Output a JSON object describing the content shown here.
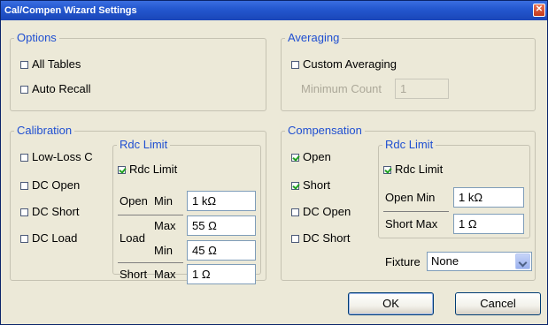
{
  "window": {
    "title": "Cal/Compen Wizard Settings",
    "close_glyph": "✕"
  },
  "options": {
    "title": "Options",
    "all_tables": {
      "label": "All Tables",
      "checked": false
    },
    "auto_recall": {
      "label": "Auto Recall",
      "checked": false
    }
  },
  "averaging": {
    "title": "Averaging",
    "custom_averaging": {
      "label": "Custom Averaging",
      "checked": false
    },
    "minimum_count_label": "Minimum Count",
    "minimum_count_value": "1"
  },
  "calibration": {
    "title": "Calibration",
    "low_loss_c": {
      "label": "Low-Loss C",
      "checked": false
    },
    "dc_open": {
      "label": "DC Open",
      "checked": false
    },
    "dc_short": {
      "label": "DC Short",
      "checked": false
    },
    "dc_load": {
      "label": "DC Load",
      "checked": false
    },
    "rdc": {
      "title": "Rdc Limit",
      "enable": {
        "label": "Rdc Limit",
        "checked": true
      },
      "open_label": "Open",
      "open_min_label": "Min",
      "open_min": "1 kΩ",
      "load_label": "Load",
      "load_max_label": "Max",
      "load_max": "55 Ω",
      "load_min_label": "Min",
      "load_min": "45 Ω",
      "short_label": "Short",
      "short_max_label": "Max",
      "short_max": "1 Ω"
    }
  },
  "compensation": {
    "title": "Compensation",
    "open": {
      "label": "Open",
      "checked": true
    },
    "short": {
      "label": "Short",
      "checked": true
    },
    "dc_open": {
      "label": "DC Open",
      "checked": false
    },
    "dc_short": {
      "label": "DC Short",
      "checked": false
    },
    "rdc": {
      "title": "Rdc Limit",
      "enable": {
        "label": "Rdc Limit",
        "checked": true
      },
      "open_min_label": "Open Min",
      "open_min": "1 kΩ",
      "short_max_label": "Short Max",
      "short_max": "1 Ω"
    },
    "fixture_label": "Fixture",
    "fixture_value": "None"
  },
  "buttons": {
    "ok": "OK",
    "cancel": "Cancel"
  },
  "colors": {
    "group_title": "#1f4fd1",
    "titlebar": "#2458d0",
    "check_mark": "#21a121"
  }
}
